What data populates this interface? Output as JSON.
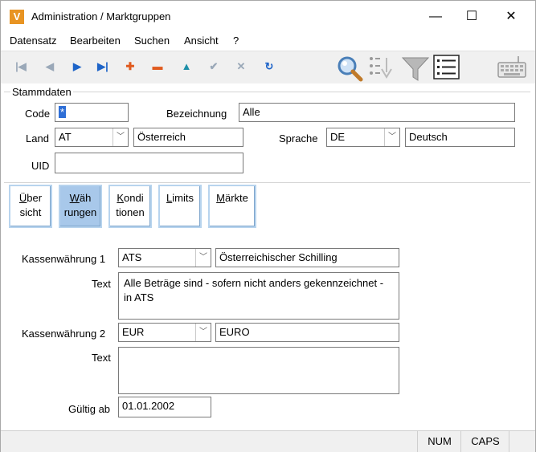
{
  "window": {
    "title": "Administration / Marktgruppen",
    "app_icon": "V"
  },
  "window_buttons": {
    "minimize": "—",
    "maximize": "☐",
    "close": "✕"
  },
  "menu": [
    "Datensatz",
    "Bearbeiten",
    "Suchen",
    "Ansicht",
    "?"
  ],
  "toolbar": {
    "icons": [
      {
        "name": "first-record-icon",
        "glyph": "|◀",
        "color": "#9aa8b8"
      },
      {
        "name": "prev-record-icon",
        "glyph": "◀",
        "color": "#9aa8b8"
      },
      {
        "name": "next-record-icon",
        "glyph": "▶",
        "color": "#1e64c8"
      },
      {
        "name": "last-record-icon",
        "glyph": "▶|",
        "color": "#1e64c8"
      },
      {
        "name": "add-record-icon",
        "glyph": "✚",
        "color": "#e05a1e"
      },
      {
        "name": "delete-record-icon",
        "glyph": "▬",
        "color": "#e05a1e"
      },
      {
        "name": "up-icon",
        "glyph": "▲",
        "color": "#1e8fa8"
      },
      {
        "name": "confirm-icon",
        "glyph": "✔",
        "color": "#9aa8b8"
      },
      {
        "name": "cancel-icon",
        "glyph": "✕",
        "color": "#9aa8b8"
      },
      {
        "name": "refresh-icon",
        "glyph": "↻",
        "color": "#1e64c8"
      }
    ]
  },
  "stammdaten": {
    "group_title": "Stammdaten",
    "code_label": "Code",
    "code_value": "*",
    "bezeichnung_label": "Bezeichnung",
    "bezeichnung_value": "Alle",
    "land_label": "Land",
    "land_value": "AT",
    "land_name": "Österreich",
    "sprache_label": "Sprache",
    "sprache_value": "DE",
    "sprache_name": "Deutsch",
    "uid_label": "UID",
    "uid_value": ""
  },
  "tabs": [
    {
      "line1": "Über",
      "line2": "sicht",
      "acc": "Ü",
      "rest1": "ber"
    },
    {
      "line1": "Wäh",
      "line2": "rungen",
      "acc": "W",
      "rest1": "äh"
    },
    {
      "line1": "Kondi",
      "line2": "tionen",
      "acc": "K",
      "rest1": "ondi"
    },
    {
      "line1": "Limits",
      "line2": "",
      "acc": "L",
      "rest1": "imits"
    },
    {
      "line1": "Märkte",
      "line2": "",
      "acc": "M",
      "rest1": "ärkte"
    }
  ],
  "waehrungen": {
    "kasse1_label": "Kassenwährung 1",
    "kasse1_code": "ATS",
    "kasse1_name": "Österreichischer Schilling",
    "text1_label": "Text",
    "text1_value": "Alle Beträge sind -  sofern nicht anders gekennzeichnet -  in ATS",
    "kasse2_label": "Kassenwährung 2",
    "kasse2_code": "EUR",
    "kasse2_name": "EURO",
    "text2_label": "Text",
    "text2_value": "",
    "gueltig_label": "Gültig ab",
    "gueltig_value": "01.01.2002"
  },
  "status": {
    "num": "NUM",
    "caps": "CAPS"
  }
}
